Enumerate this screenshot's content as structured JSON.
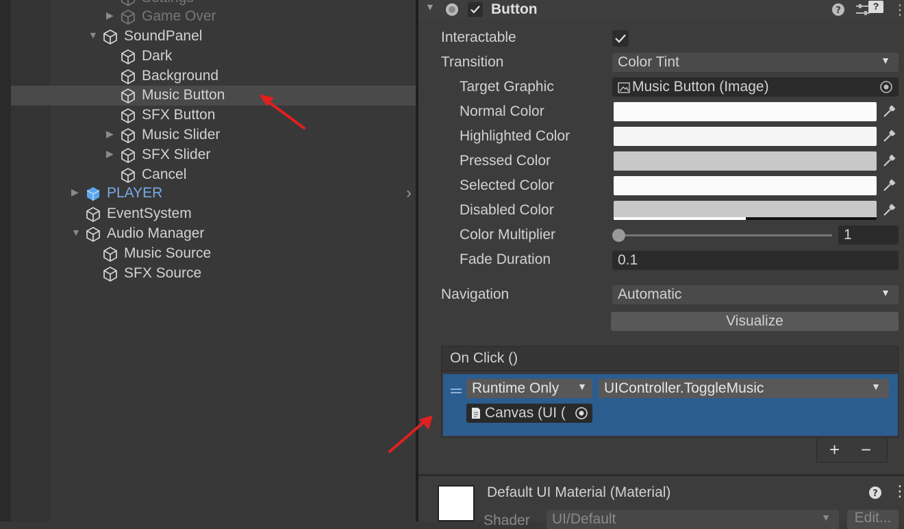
{
  "hierarchy": {
    "items": [
      {
        "label": "Settings"
      },
      {
        "label": "Game Over"
      },
      {
        "label": "SoundPanel"
      },
      {
        "label": "Dark"
      },
      {
        "label": "Background"
      },
      {
        "label": "Music Button"
      },
      {
        "label": "SFX Button"
      },
      {
        "label": "Music Slider"
      },
      {
        "label": "SFX Slider"
      },
      {
        "label": "Cancel"
      },
      {
        "label": "PLAYER"
      },
      {
        "label": "EventSystem"
      },
      {
        "label": "Audio Manager"
      },
      {
        "label": "Music Source"
      },
      {
        "label": "SFX Source"
      }
    ]
  },
  "inspector": {
    "component_title": "Button",
    "component_enabled": true,
    "interactable_label": "Interactable",
    "interactable_checked": true,
    "transition_label": "Transition",
    "transition_value": "Color Tint",
    "target_graphic_label": "Target Graphic",
    "target_graphic_value": "Music Button (Image)",
    "normal_color_label": "Normal Color",
    "highlighted_color_label": "Highlighted Color",
    "pressed_color_label": "Pressed Color",
    "selected_color_label": "Selected Color",
    "disabled_color_label": "Disabled Color",
    "color_multiplier_label": "Color Multiplier",
    "color_multiplier_value": "1",
    "fade_duration_label": "Fade Duration",
    "fade_duration_value": "0.1",
    "navigation_label": "Navigation",
    "navigation_value": "Automatic",
    "visualize_label": "Visualize",
    "onclick": {
      "title": "On Click ()",
      "runtime_value": "Runtime Only",
      "function_value": "UIController.ToggleMusic",
      "object_value": "Canvas (UI (",
      "plus": "+",
      "minus": "−"
    },
    "material": {
      "title": "Default UI Material (Material)",
      "shader_label": "Shader",
      "shader_value": "UI/Default",
      "edit_label": "Edit..."
    }
  },
  "colors": {
    "selection": "#2c5d8f",
    "arrow": "#e02020",
    "player": "#7aa8e8"
  }
}
